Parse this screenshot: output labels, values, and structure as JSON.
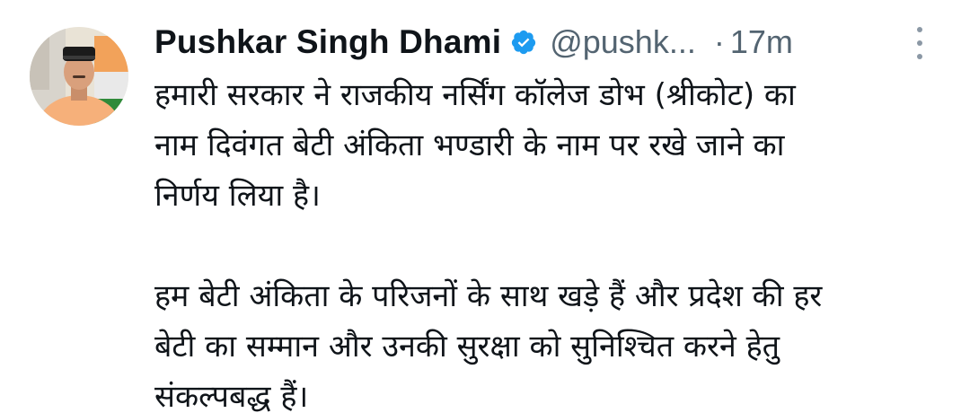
{
  "tweet": {
    "author_name": "Pushkar Singh Dhami",
    "handle": "@pushk...",
    "separator": "·",
    "time": "17m",
    "paragraphs": [
      {
        "lines": [
          "हमारी सरकार ने राजकीय नर्सिंग कॉलेज डोभ (श्रीकोट) का",
          "नाम दिवंगत बेटी अंकिता भण्डारी के नाम पर रखे जाने का",
          "निर्णय लिया है।"
        ]
      },
      {
        "lines": [
          "हम बेटी अंकिता के परिजनों के साथ खड़े हैं और प्रदेश की हर",
          "बेटी का सम्मान और उनकी सुरक्षा को सुनिश्चित करने हेतु",
          "संकल्पबद्ध हैं।"
        ]
      }
    ]
  },
  "icons": {
    "verified": "verified-badge-icon",
    "more": "more-options-icon",
    "avatar": "profile-avatar"
  },
  "colors": {
    "text": "#0f1419",
    "secondary": "#536471",
    "verified_blue": "#1d9bf0"
  }
}
